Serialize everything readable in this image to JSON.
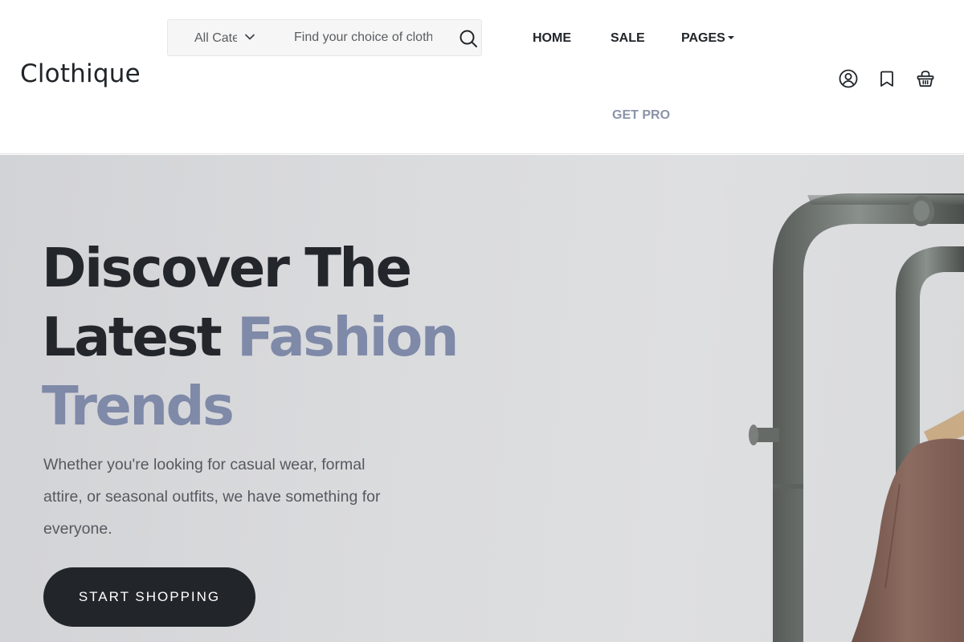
{
  "header": {
    "logo": "Clothique",
    "search": {
      "category_selected": "All Categories",
      "placeholder": "Find your choice of clothes"
    },
    "nav": {
      "home": "HOME",
      "sale": "SALE",
      "pages": "PAGES",
      "get_pro": "GET PRO"
    },
    "icons": {
      "account": "user-circle-icon",
      "wishlist": "bookmark-icon",
      "cart": "shopping-basket-icon"
    }
  },
  "hero": {
    "headline": {
      "line1_bold": "Discover",
      "line1_rest": " The",
      "line2_plain": "Latest ",
      "line2_accent": "Fashion",
      "line3_accent": "Trends"
    },
    "subtext": "Whether you're looking for casual wear, formal attire, or seasonal outfits, we have something for everyone.",
    "cta_label": "START SHOPPING"
  },
  "colors": {
    "accent": "#7f89a8",
    "dark": "#22262b",
    "hero_background": "#dadbdd"
  }
}
